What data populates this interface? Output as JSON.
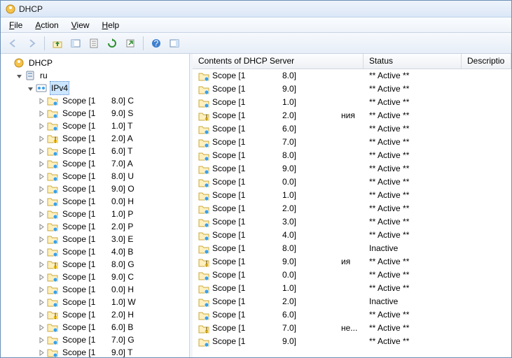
{
  "window": {
    "title": "DHCP"
  },
  "menu": {
    "file": "File",
    "action": "Action",
    "view": "View",
    "help": "Help"
  },
  "toolbar": {
    "back": "back",
    "forward": "forward",
    "up": "up",
    "show_hide": "show-hide",
    "export": "export",
    "refresh": "refresh",
    "stop": "stop",
    "help": "help",
    "panel": "panel"
  },
  "tree": {
    "root": "DHCP",
    "server": "ru",
    "ipv4": "IPv4",
    "scopes": [
      {
        "n": "Scope [1",
        "v": "8.0] C"
      },
      {
        "n": "Scope [1",
        "v": "9.0] S"
      },
      {
        "n": "Scope [1",
        "v": "1.0] T"
      },
      {
        "n": "Scope [1",
        "v": "2.0] A"
      },
      {
        "n": "Scope [1",
        "v": "6.0] T"
      },
      {
        "n": "Scope [1",
        "v": "7.0] A"
      },
      {
        "n": "Scope [1",
        "v": "8.0] U"
      },
      {
        "n": "Scope [1",
        "v": "9.0] O"
      },
      {
        "n": "Scope [1",
        "v": "0.0] H"
      },
      {
        "n": "Scope [1",
        "v": "1.0] P"
      },
      {
        "n": "Scope [1",
        "v": "2.0] P"
      },
      {
        "n": "Scope [1",
        "v": "3.0] E"
      },
      {
        "n": "Scope [1",
        "v": "4.0] B"
      },
      {
        "n": "Scope [1",
        "v": "8.0] G"
      },
      {
        "n": "Scope [1",
        "v": "9.0] C"
      },
      {
        "n": "Scope [1",
        "v": "0.0] H"
      },
      {
        "n": "Scope [1",
        "v": "1.0] W"
      },
      {
        "n": "Scope [1",
        "v": "2.0] H"
      },
      {
        "n": "Scope [1",
        "v": "6.0] B"
      },
      {
        "n": "Scope [1",
        "v": "7.0] G"
      },
      {
        "n": "Scope [1",
        "v": "9.0] T"
      }
    ]
  },
  "list": {
    "h1": "Contents of DHCP Server",
    "h2": "Status",
    "h3": "Descriptio",
    "rows": [
      {
        "n": "Scope [1",
        "v": "8.0]",
        "extra": "",
        "status": "** Active **",
        "warn": false
      },
      {
        "n": "Scope [1",
        "v": "9.0]",
        "extra": "",
        "status": "** Active **",
        "warn": false
      },
      {
        "n": "Scope [1",
        "v": "1.0]",
        "extra": "",
        "status": "** Active **",
        "warn": false
      },
      {
        "n": "Scope [1",
        "v": "2.0]",
        "extra": "ния",
        "status": "** Active **",
        "warn": true
      },
      {
        "n": "Scope [1",
        "v": "6.0]",
        "extra": "",
        "status": "** Active **",
        "warn": false
      },
      {
        "n": "Scope [1",
        "v": "7.0]",
        "extra": "",
        "status": "** Active **",
        "warn": false
      },
      {
        "n": "Scope [1",
        "v": "8.0]",
        "extra": "",
        "status": "** Active **",
        "warn": false
      },
      {
        "n": "Scope [1",
        "v": "9.0]",
        "extra": "",
        "status": "** Active **",
        "warn": false
      },
      {
        "n": "Scope [1",
        "v": "0.0]",
        "extra": "",
        "status": "** Active **",
        "warn": false
      },
      {
        "n": "Scope [1",
        "v": "1.0]",
        "extra": "",
        "status": "** Active **",
        "warn": false
      },
      {
        "n": "Scope [1",
        "v": "2.0]",
        "extra": "",
        "status": "** Active **",
        "warn": false
      },
      {
        "n": "Scope [1",
        "v": "3.0]",
        "extra": "",
        "status": "** Active **",
        "warn": false
      },
      {
        "n": "Scope [1",
        "v": "4.0]",
        "extra": "",
        "status": "** Active **",
        "warn": false
      },
      {
        "n": "Scope [1",
        "v": "8.0]",
        "extra": "",
        "status": "Inactive",
        "warn": false
      },
      {
        "n": "Scope [1",
        "v": "9.0]",
        "extra": "ия",
        "status": "** Active **",
        "warn": true
      },
      {
        "n": "Scope [1",
        "v": "0.0]",
        "extra": "",
        "status": "** Active **",
        "warn": false
      },
      {
        "n": "Scope [1",
        "v": "1.0]",
        "extra": "",
        "status": "** Active **",
        "warn": false
      },
      {
        "n": "Scope [1",
        "v": "2.0]",
        "extra": "",
        "status": "Inactive",
        "warn": false
      },
      {
        "n": "Scope [1",
        "v": "6.0]",
        "extra": "",
        "status": "** Active **",
        "warn": false
      },
      {
        "n": "Scope [1",
        "v": "7.0]",
        "extra": "не...",
        "status": "** Active **",
        "warn": true
      },
      {
        "n": "Scope [1",
        "v": "9.0]",
        "extra": "",
        "status": "** Active **",
        "warn": false
      }
    ]
  }
}
